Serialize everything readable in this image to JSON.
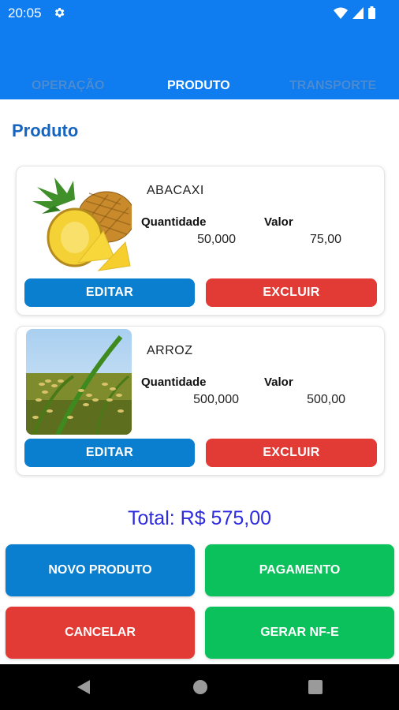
{
  "status_bar": {
    "time": "20:05",
    "gear_icon": "gear-icon",
    "wifi_icon": "wifi-icon",
    "signal_icon": "signal-icon",
    "battery_icon": "battery-icon"
  },
  "tabs": [
    {
      "label": "OPERAÇÃO",
      "active": false
    },
    {
      "label": "PRODUTO",
      "active": true
    },
    {
      "label": "TRANSPORTE",
      "active": false
    }
  ],
  "page_title": "Produto",
  "products": [
    {
      "name": "ABACAXI",
      "qty_label": "Quantidade",
      "value_label": "Valor",
      "quantity": "50,000",
      "value": "75,00",
      "edit_label": "EDITAR",
      "delete_label": "EXCLUIR",
      "image": "pineapple-image"
    },
    {
      "name": "ARROZ",
      "qty_label": "Quantidade",
      "value_label": "Valor",
      "quantity": "500,000",
      "value": "500,00",
      "edit_label": "EDITAR",
      "delete_label": "EXCLUIR",
      "image": "rice-plant-image"
    }
  ],
  "total": "Total: R$ 575,00",
  "actions": {
    "new_product": "NOVO PRODUTO",
    "payment": "PAGAMENTO",
    "cancel": "CANCELAR",
    "generate_nfe": "GERAR NF-E"
  },
  "colors": {
    "app_bar": "#0f7cf0",
    "primary_button": "#0a7fd0",
    "danger_button": "#e23b36",
    "success_button": "#0bc15c",
    "total_text": "#2d2adf",
    "title": "#1565c0"
  },
  "nav_bar": {
    "back_icon": "back-triangle-icon",
    "home_icon": "home-circle-icon",
    "recents_icon": "recents-square-icon"
  }
}
